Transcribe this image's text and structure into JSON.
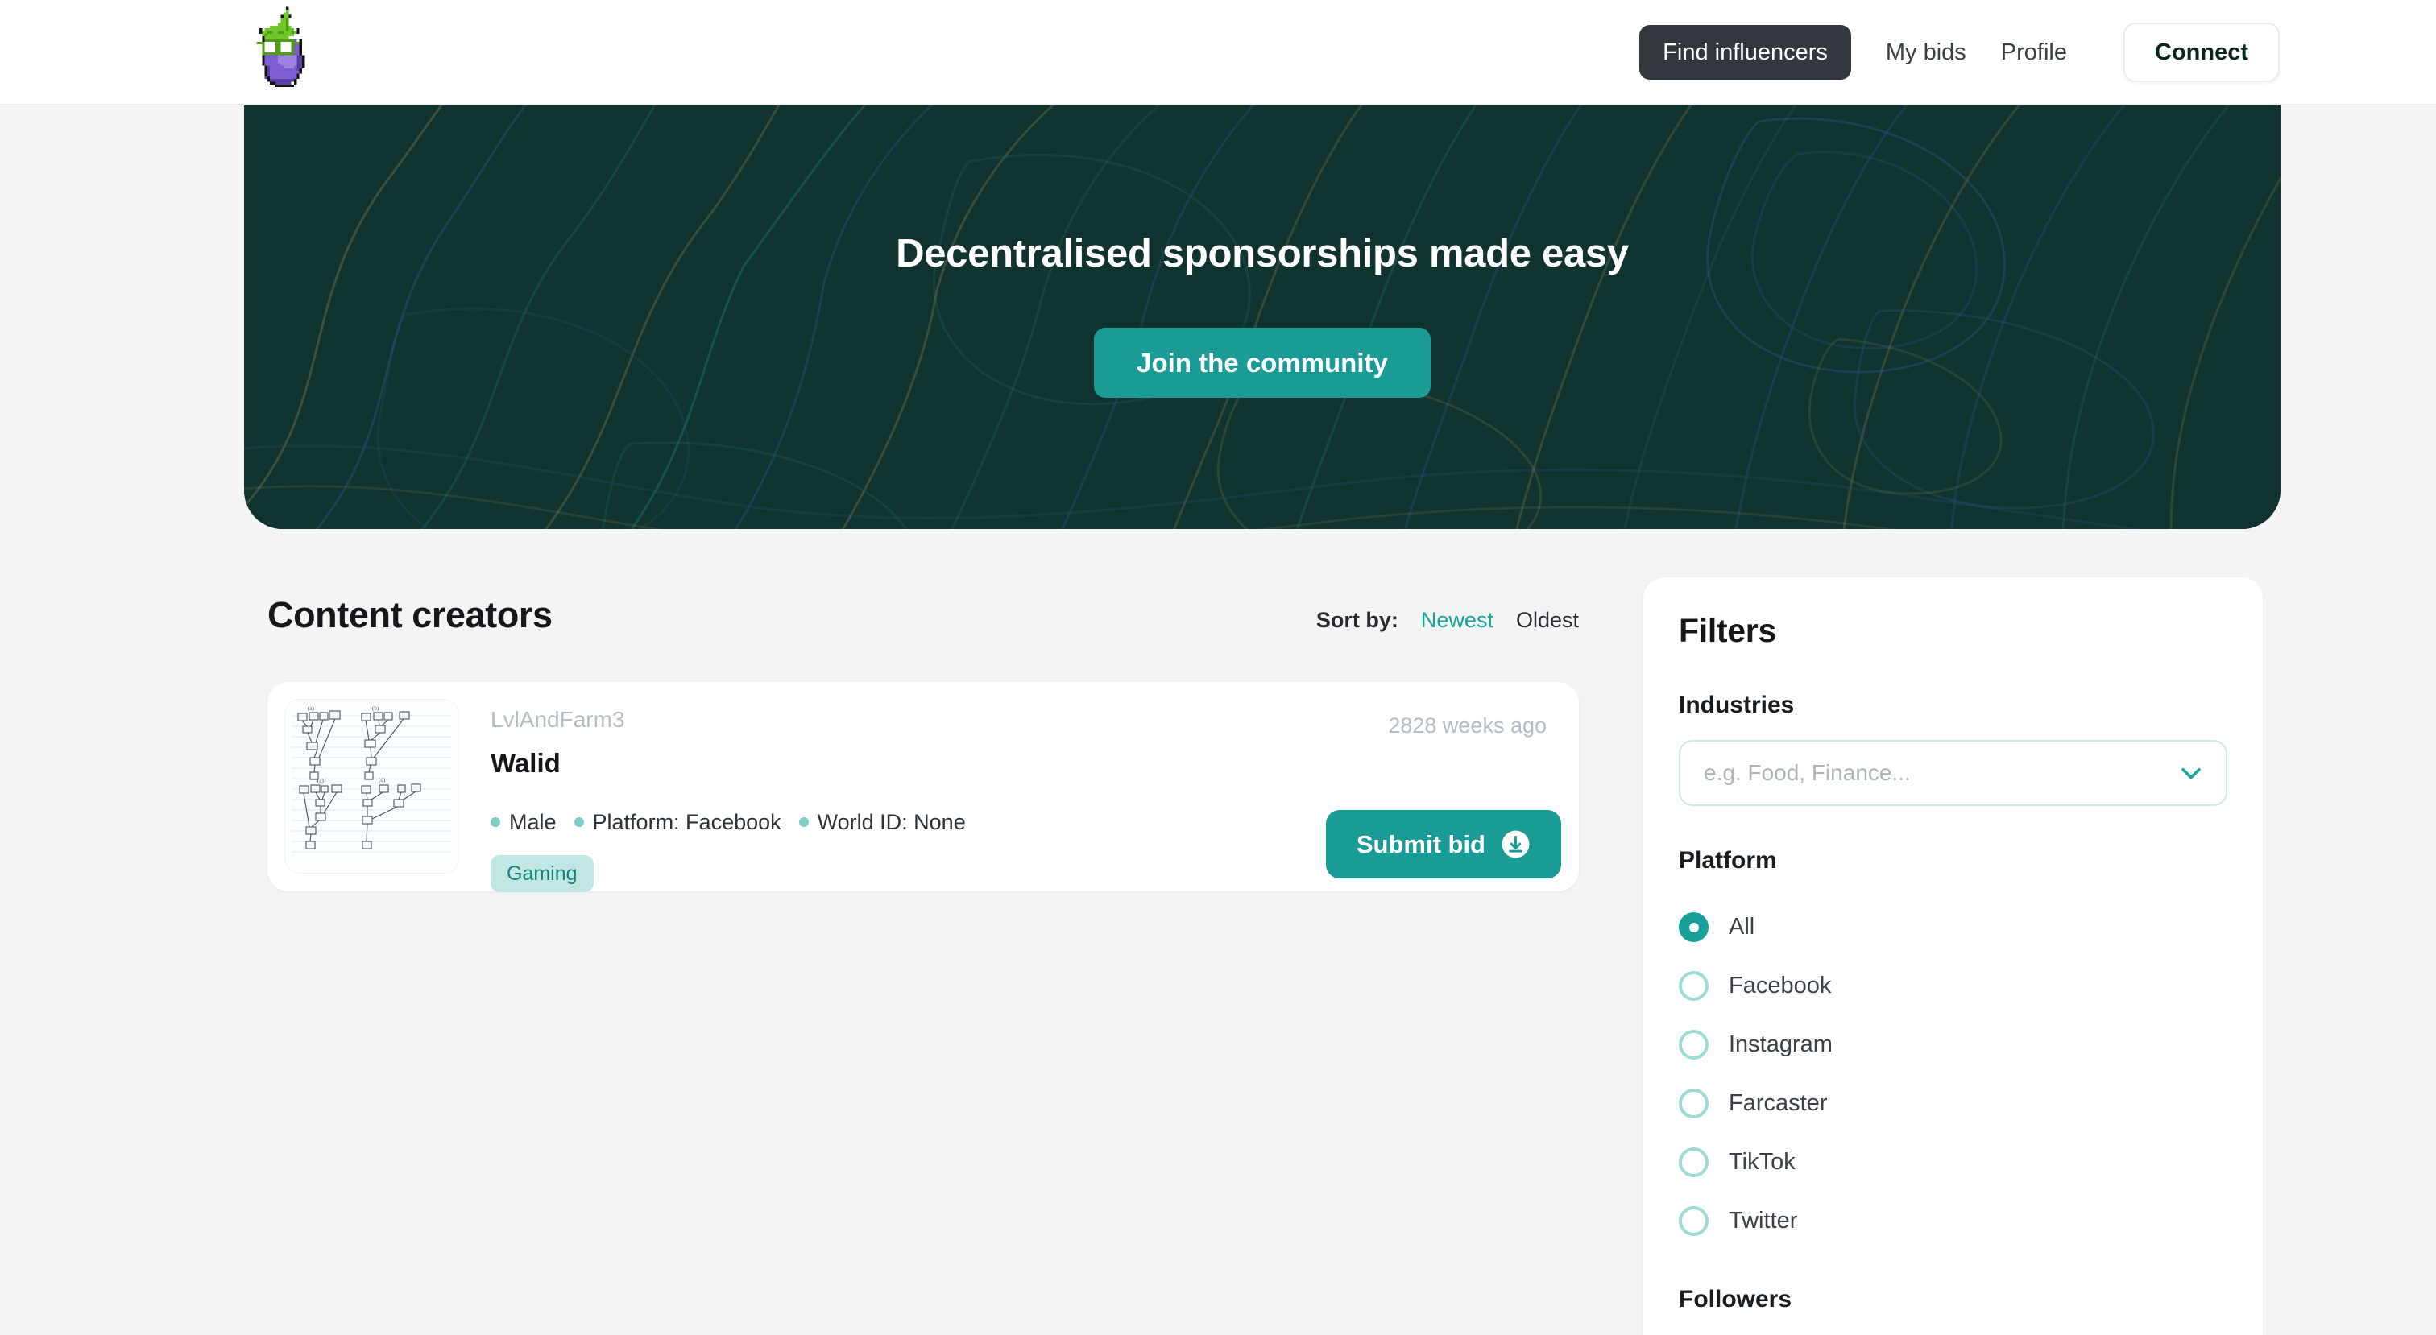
{
  "header": {
    "logo_icon": "eggplant-pixel-logo",
    "nav": [
      {
        "label": "Find influencers",
        "active": true
      },
      {
        "label": "My bids",
        "active": false
      },
      {
        "label": "Profile",
        "active": false
      }
    ],
    "connect_label": "Connect"
  },
  "hero": {
    "title": "Decentralised sponsorships made easy",
    "cta_label": "Join the community",
    "background_color": "#10332F",
    "cta_color": "#1B9B95"
  },
  "main": {
    "section_title": "Content creators",
    "sort": {
      "label": "Sort by:",
      "options": [
        {
          "label": "Newest",
          "active": true
        },
        {
          "label": "Oldest",
          "active": false
        }
      ],
      "active_color": "#16A39B"
    },
    "creators": [
      {
        "handle": "LvlAndFarm3",
        "name": "Walid",
        "time_ago": "2828 weeks ago",
        "meta": [
          "Male",
          "Platform: Facebook",
          "World ID: None"
        ],
        "tags": [
          "Gaming"
        ],
        "action_label": "Submit bid",
        "action_icon": "download-circle-icon",
        "avatar_alt": "hand-drawn-tree-diagrams-sketch"
      }
    ]
  },
  "filters": {
    "title": "Filters",
    "industries": {
      "label": "Industries",
      "placeholder": "e.g. Food, Finance...",
      "value": "",
      "chevron_icon": "chevron-down-icon"
    },
    "platform": {
      "label": "Platform",
      "options": [
        {
          "label": "All",
          "selected": true
        },
        {
          "label": "Facebook",
          "selected": false
        },
        {
          "label": "Instagram",
          "selected": false
        },
        {
          "label": "Farcaster",
          "selected": false
        },
        {
          "label": "TikTok",
          "selected": false
        },
        {
          "label": "Twitter",
          "selected": false
        }
      ]
    },
    "followers": {
      "label": "Followers"
    }
  }
}
